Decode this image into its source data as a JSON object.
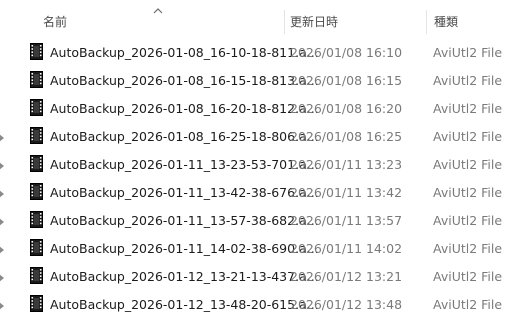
{
  "columns": {
    "name": "名前",
    "date": "更新日時",
    "type": "種類"
  },
  "sort": {
    "column": "name",
    "direction": "ascending",
    "icon": "chevron-up-icon"
  },
  "file_icon": "aviutl2-file-icon",
  "files": [
    {
      "name": "AutoBackup_2026-01-08_16-10-18-811.a...",
      "date": "2026/01/08 16:10",
      "type": "AviUtl2 File",
      "expander": false
    },
    {
      "name": "AutoBackup_2026-01-08_16-15-18-813.a...",
      "date": "2026/01/08 16:15",
      "type": "AviUtl2 File",
      "expander": false
    },
    {
      "name": "AutoBackup_2026-01-08_16-20-18-812.a...",
      "date": "2026/01/08 16:20",
      "type": "AviUtl2 File",
      "expander": false
    },
    {
      "name": "AutoBackup_2026-01-08_16-25-18-806.a...",
      "date": "2026/01/08 16:25",
      "type": "AviUtl2 File",
      "expander": true
    },
    {
      "name": "AutoBackup_2026-01-11_13-23-53-701.a...",
      "date": "2026/01/11 13:23",
      "type": "AviUtl2 File",
      "expander": true
    },
    {
      "name": "AutoBackup_2026-01-11_13-42-38-676.a...",
      "date": "2026/01/11 13:42",
      "type": "AviUtl2 File",
      "expander": true
    },
    {
      "name": "AutoBackup_2026-01-11_13-57-38-682.a...",
      "date": "2026/01/11 13:57",
      "type": "AviUtl2 File",
      "expander": true
    },
    {
      "name": "AutoBackup_2026-01-11_14-02-38-690.a...",
      "date": "2026/01/11 14:02",
      "type": "AviUtl2 File",
      "expander": true
    },
    {
      "name": "AutoBackup_2026-01-12_13-21-13-437.a...",
      "date": "2026/01/12 13:21",
      "type": "AviUtl2 File",
      "expander": true
    },
    {
      "name": "AutoBackup_2026-01-12_13-48-20-615.a...",
      "date": "2026/01/12 13:48",
      "type": "AviUtl2 File",
      "expander": true
    }
  ]
}
